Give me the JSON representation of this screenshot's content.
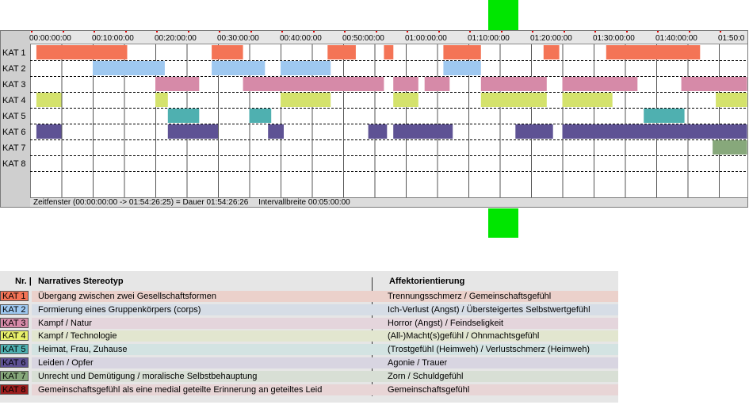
{
  "timeline": {
    "time_labels": [
      "00:00:00:00",
      "00:10:00:00",
      "00:20:00:00",
      "00:30:00:00",
      "00:40:00:00",
      "00:50:00:00",
      "01:00:00:00",
      "01:10:00:00",
      "01:20:00:00",
      "01:30:00:00",
      "01:40:00:00",
      "01:50:0"
    ],
    "status": {
      "window": "Zeitfenster (00:00:00:00 -> 01:54:26:25) = Dauer 01:54:26:26",
      "interval": "Intervallbreite 00:05:00:00"
    },
    "rows": [
      {
        "label": "KAT 1",
        "color": "#f47456",
        "segments_min": [
          [
            1,
            15.5
          ],
          [
            29,
            34
          ],
          [
            47.5,
            52
          ],
          [
            56.5,
            58
          ],
          [
            66,
            72
          ],
          [
            82,
            84.5
          ],
          [
            92,
            107
          ]
        ]
      },
      {
        "label": "KAT 2",
        "color": "#9ec8f0",
        "segments_min": [
          [
            10,
            21.5
          ],
          [
            29,
            37.5
          ],
          [
            40,
            48
          ],
          [
            66,
            72
          ]
        ]
      },
      {
        "label": "KAT 3",
        "color": "#d68aa8",
        "segments_min": [
          [
            20,
            27
          ],
          [
            34,
            56.5
          ],
          [
            58,
            62
          ],
          [
            63,
            67
          ],
          [
            72,
            82.5
          ],
          [
            85,
            97
          ],
          [
            104,
            114.5
          ]
        ]
      },
      {
        "label": "KAT 4",
        "color": "#d4e26c",
        "segments_min": [
          [
            1,
            5
          ],
          [
            20,
            22
          ],
          [
            40,
            48
          ],
          [
            58,
            62
          ],
          [
            72,
            82.5
          ],
          [
            85,
            93
          ],
          [
            109.5,
            114.5
          ]
        ]
      },
      {
        "label": "KAT 5",
        "color": "#4fb0b0",
        "segments_min": [
          [
            22,
            27
          ],
          [
            35,
            38.5
          ],
          [
            98,
            104.5
          ]
        ]
      },
      {
        "label": "KAT 6",
        "color": "#5e5294",
        "segments_min": [
          [
            1,
            5
          ],
          [
            22,
            30
          ],
          [
            38,
            40.5
          ],
          [
            54,
            57
          ],
          [
            58,
            67.5
          ],
          [
            77.5,
            83.5
          ],
          [
            85,
            114.5
          ]
        ]
      },
      {
        "label": "KAT 7",
        "color": "#87a87b",
        "segments_min": [
          [
            109,
            114.5
          ]
        ]
      },
      {
        "label": "KAT 8",
        "color": "#9b1e1e",
        "segments_min": []
      }
    ]
  },
  "legend": {
    "header_nr": "Nr. |",
    "header_stereotype": "Narratives Stereotyp",
    "header_affect": "Affektorientierung",
    "items": [
      {
        "code": "KAT 1",
        "color": "#f47456",
        "tint": "#ebd1cb",
        "stereotype": "Übergang zwischen zwei Gesellschaftsformen",
        "affect": "Trennungsschmerz / Gemeinschaftsgefühl"
      },
      {
        "code": "KAT 2",
        "color": "#9ec8f0",
        "tint": "#d6dde6",
        "stereotype": "Formierung eines Gruppenkörpers (corps)",
        "affect": "Ich-Verlust (Angst) / Übersteigertes Selbstwertgefühl"
      },
      {
        "code": "KAT 3",
        "color": "#d68aa8",
        "tint": "#e4d5dc",
        "stereotype": "Kampf / Natur",
        "affect": "Horror (Angst) / Feindseligkeit"
      },
      {
        "code": "KAT 4",
        "color": "#e8f06a",
        "tint": "#e2e6cf",
        "stereotype": "Kampf / Technologie",
        "affect": "(All-)Macht(s)gefühl / Ohnmachtsgefühl"
      },
      {
        "code": "KAT 5",
        "color": "#4fb0b0",
        "tint": "#d3e3e2",
        "stereotype": "Heimat, Frau, Zuhause",
        "affect": "(Trostgefühl (Heimweh) / Verlustschmerz (Heimweh)"
      },
      {
        "code": "KAT 6",
        "color": "#5e5294",
        "tint": "#d8d5e1",
        "stereotype": "Leiden / Opfer",
        "affect": "Agonie / Trauer"
      },
      {
        "code": "KAT 7",
        "color": "#87a87b",
        "tint": "#d8dfd5",
        "stereotype": "Unrecht und Demütigung / moralische Selbstbehauptung",
        "affect": "Zorn / Schuldgefühl"
      },
      {
        "code": "KAT 8",
        "color": "#9b1e1e",
        "tint": "#e8d5d6",
        "stereotype": "Gemeinschaftsgefühl als eine medial geteilte Erinnerung an geteiltes Leid",
        "affect": "Gemeinschaftsgefühl"
      }
    ]
  }
}
